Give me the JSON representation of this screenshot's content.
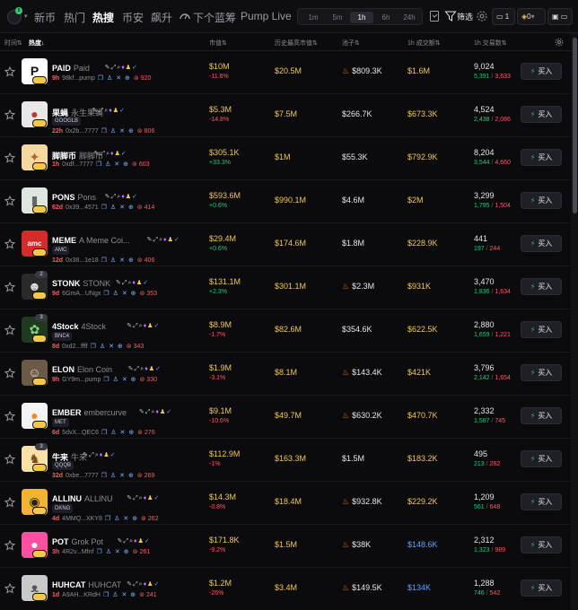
{
  "nav": {
    "logo_badge": "8",
    "tabs": [
      "新币",
      "热门",
      "热搜",
      "币安",
      "飙升",
      "下个蓝筹",
      "Pump Live"
    ],
    "active_tab": "热搜",
    "timeframes": [
      "1m",
      "5m",
      "1h",
      "6h",
      "24h"
    ],
    "active_timeframe": "1h",
    "filter_label": "筛选",
    "wallet_count": "1",
    "balance": "0"
  },
  "table": {
    "headers": {
      "time": "时间",
      "hot": "热度",
      "mcap": "市值",
      "ath": "历史最高市值",
      "pool": "池子",
      "vol": "1h 成交额",
      "txs": "1h 交易数"
    },
    "buy_label": "买入",
    "rows": [
      {
        "symbol": "PAID",
        "name": "Paid",
        "age": "9h",
        "addr": "98kf...pump",
        "holders": "920",
        "mcap": "$10M",
        "chg": "-11.6%",
        "chg_dir": "neg",
        "ath": "$20.5M",
        "pool": "$809.3K",
        "pool_fire": true,
        "vol": "$1.6M",
        "vol_color": "yellow",
        "tx": "9,024",
        "buys": "5,391",
        "sells": "3,633",
        "avatar_bg": "#ffffff",
        "avatar_fg": "#111111",
        "avatar_text": "P"
      },
      {
        "symbol": "果蝇",
        "name": "永生果蝇",
        "tag": "GOOGLB",
        "age": "22h",
        "addr": "0x2b...7777",
        "holders": "806",
        "mcap": "$5.3M",
        "chg": "-14.8%",
        "chg_dir": "neg",
        "ath": "$7.5M",
        "pool": "$266.7K",
        "pool_fire": false,
        "vol": "$673.3K",
        "vol_color": "yellow",
        "tx": "4,524",
        "buys": "2,438",
        "sells": "2,086",
        "avatar_bg": "#e8e8e8",
        "avatar_fg": "#c0392b",
        "avatar_text": "●"
      },
      {
        "symbol": "脚脚币",
        "name": "脚脚币",
        "age": "1h",
        "addr": "0xdf...7777",
        "holders": "603",
        "mcap": "$305.1K",
        "chg": "+33.3%",
        "chg_dir": "pos",
        "ath": "$1M",
        "pool": "$55.3K",
        "pool_fire": false,
        "vol": "$792.9K",
        "vol_color": "yellow",
        "tx": "8,204",
        "buys": "3,544",
        "sells": "4,660",
        "avatar_bg": "#f5d7a1",
        "avatar_fg": "#b5651d",
        "avatar_text": "✦"
      },
      {
        "symbol": "PONS",
        "name": "Pons",
        "age": "62d",
        "addr": "0x39...4571",
        "holders": "414",
        "mcap": "$593.6M",
        "chg": "+0.6%",
        "chg_dir": "pos",
        "ath": "$990.1M",
        "pool": "$4.6M",
        "pool_fire": false,
        "vol": "$2M",
        "vol_color": "yellow",
        "tx": "3,299",
        "buys": "1,795",
        "sells": "1,504",
        "avatar_bg": "#dfe6df",
        "avatar_fg": "#666666",
        "avatar_text": "▮"
      },
      {
        "symbol": "MEME",
        "name": "A Meme Coi...",
        "tag": "AMC",
        "age": "12d",
        "addr": "0x38...1e18",
        "holders": "406",
        "mcap": "$29.4M",
        "chg": "+0.6%",
        "chg_dir": "pos",
        "ath": "$174.6M",
        "pool": "$1.8M",
        "pool_fire": false,
        "vol": "$228.9K",
        "vol_color": "yellow",
        "tx": "441",
        "buys": "197",
        "sells": "244",
        "avatar_bg": "#d62b2b",
        "avatar_fg": "#ffffff",
        "avatar_text": "amc"
      },
      {
        "symbol": "STONK",
        "name": "STONK",
        "rank": "2",
        "age": "9d",
        "addr": "6GmA...UNgx",
        "holders": "353",
        "mcap": "$131.1M",
        "chg": "+2.3%",
        "chg_dir": "pos",
        "ath": "$301.1M",
        "pool": "$2.3M",
        "pool_fire": true,
        "vol": "$931K",
        "vol_color": "yellow",
        "tx": "3,470",
        "buys": "1,836",
        "sells": "1,634",
        "avatar_bg": "#2a2a2a",
        "avatar_fg": "#dddddd",
        "avatar_text": "☻"
      },
      {
        "symbol": "4Stock",
        "name": "4Stock",
        "rank": "3",
        "tag": "BNC4",
        "age": "8d",
        "addr": "0xd2...ffff",
        "holders": "343",
        "mcap": "$8.9M",
        "chg": "-1.7%",
        "chg_dir": "neg",
        "ath": "$82.6M",
        "pool": "$354.6K",
        "pool_fire": false,
        "vol": "$622.5K",
        "vol_color": "yellow",
        "tx": "2,880",
        "buys": "1,659",
        "sells": "1,221",
        "avatar_bg": "#1f3a1f",
        "avatar_fg": "#7fd67f",
        "avatar_text": "✿"
      },
      {
        "symbol": "ELON",
        "name": "Elon Coin",
        "age": "9h",
        "addr": "GY9m...pump",
        "holders": "330",
        "mcap": "$1.9M",
        "chg": "-3.1%",
        "chg_dir": "neg",
        "ath": "$8.1M",
        "pool": "$143.4K",
        "pool_fire": true,
        "vol": "$421K",
        "vol_color": "yellow",
        "tx": "3,796",
        "buys": "2,142",
        "sells": "1,654",
        "avatar_bg": "#6b5a48",
        "avatar_fg": "#e8d8c0",
        "avatar_text": "☺"
      },
      {
        "symbol": "EMBER",
        "name": "embercurve",
        "tag": "MET",
        "age": "6d",
        "addr": "5dvX...QEC6",
        "holders": "276",
        "mcap": "$9.1M",
        "chg": "-10.6%",
        "chg_dir": "neg",
        "ath": "$49.7M",
        "pool": "$630.2K",
        "pool_fire": true,
        "vol": "$470.7K",
        "vol_color": "yellow",
        "tx": "2,332",
        "buys": "1,587",
        "sells": "745",
        "avatar_bg": "#f4f4f4",
        "avatar_fg": "#f08a24",
        "avatar_text": "●"
      },
      {
        "symbol": "牛来",
        "name": "牛来",
        "rank": "3",
        "tag": "QQQB",
        "age": "32d",
        "addr": "0xbe...7777",
        "holders": "269",
        "mcap": "$112.9M",
        "chg": "-1%",
        "chg_dir": "neg",
        "ath": "$163.3M",
        "pool": "$1.5M",
        "pool_fire": false,
        "vol": "$183.2K",
        "vol_color": "yellow",
        "tx": "495",
        "buys": "213",
        "sells": "282",
        "avatar_bg": "#f7e1a8",
        "avatar_fg": "#7a4a1a",
        "avatar_text": "♞"
      },
      {
        "symbol": "ALLINU",
        "name": "ALLINU",
        "tag": "DKNG",
        "age": "4d",
        "addr": "4MMQ...XKY8",
        "holders": "262",
        "mcap": "$14.3M",
        "chg": "-0.8%",
        "chg_dir": "neg",
        "ath": "$18.4M",
        "pool": "$932.8K",
        "pool_fire": true,
        "vol": "$229.2K",
        "vol_color": "yellow",
        "tx": "1,209",
        "buys": "561",
        "sells": "648",
        "avatar_bg": "#f2b233",
        "avatar_fg": "#222222",
        "avatar_text": "◉"
      },
      {
        "symbol": "POT",
        "name": "Grok Pot",
        "age": "3h",
        "addr": "4R2v...Mfnf",
        "holders": "261",
        "mcap": "$171.8K",
        "chg": "-9.2%",
        "chg_dir": "neg",
        "ath": "$1.5M",
        "pool": "$38K",
        "pool_fire": true,
        "vol": "$148.6K",
        "vol_color": "blue",
        "tx": "2,312",
        "buys": "1,323",
        "sells": "989",
        "avatar_bg": "#ff4fa3",
        "avatar_fg": "#ffffff",
        "avatar_text": "●"
      },
      {
        "symbol": "HUHCAT",
        "name": "HUHCAT",
        "age": "1d",
        "addr": "A9AH...KRdH",
        "holders": "241",
        "mcap": "$1.2M",
        "chg": "-26%",
        "chg_dir": "neg",
        "ath": "$3.4M",
        "pool": "$149.5K",
        "pool_fire": true,
        "vol": "$134K",
        "vol_color": "blue",
        "tx": "1,288",
        "buys": "746",
        "sells": "542",
        "avatar_bg": "#c9c9c9",
        "avatar_fg": "#555555",
        "avatar_text": "ᴥ"
      }
    ]
  }
}
